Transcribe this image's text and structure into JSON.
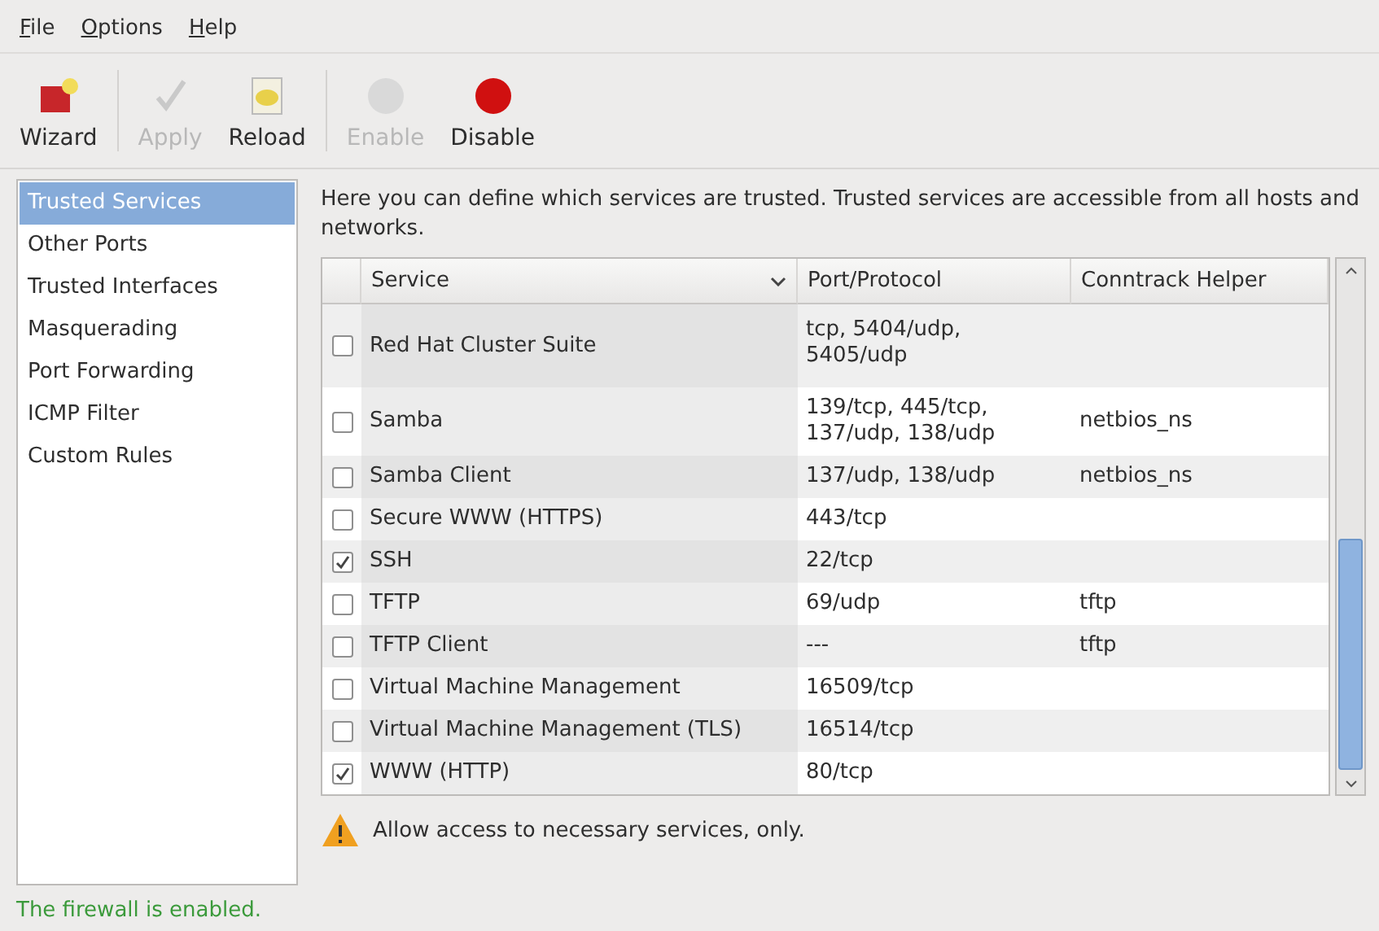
{
  "menu": [
    "File",
    "Options",
    "Help"
  ],
  "toolbar": [
    {
      "label": "Wizard",
      "kind": "wizard",
      "disabled": false
    },
    {
      "label": "Apply",
      "kind": "apply",
      "disabled": true
    },
    {
      "label": "Reload",
      "kind": "reload",
      "disabled": false
    },
    {
      "label": "Enable",
      "kind": "enable",
      "disabled": true
    },
    {
      "label": "Disable",
      "kind": "disable",
      "disabled": false
    }
  ],
  "sidebar": {
    "items": [
      {
        "label": "Trusted Services",
        "selected": true
      },
      {
        "label": "Other Ports",
        "selected": false
      },
      {
        "label": "Trusted Interfaces",
        "selected": false
      },
      {
        "label": "Masquerading",
        "selected": false
      },
      {
        "label": "Port Forwarding",
        "selected": false
      },
      {
        "label": "ICMP Filter",
        "selected": false
      },
      {
        "label": "Custom Rules",
        "selected": false
      }
    ]
  },
  "description": "Here you can define which services are trusted. Trusted services are accessible from all hosts and networks.",
  "table": {
    "columns": [
      "Service",
      "Port/Protocol",
      "Conntrack Helper"
    ],
    "rows": [
      {
        "checked": false,
        "service": "Red Hat Cluster Suite",
        "port": "tcp, 5404/udp, 5405/udp",
        "helper": ""
      },
      {
        "checked": false,
        "service": "Samba",
        "port": "139/tcp, 445/tcp, 137/udp, 138/udp",
        "helper": "netbios_ns"
      },
      {
        "checked": false,
        "service": "Samba Client",
        "port": "137/udp, 138/udp",
        "helper": "netbios_ns"
      },
      {
        "checked": false,
        "service": "Secure WWW (HTTPS)",
        "port": "443/tcp",
        "helper": ""
      },
      {
        "checked": true,
        "service": "SSH",
        "port": "22/tcp",
        "helper": ""
      },
      {
        "checked": false,
        "service": "TFTP",
        "port": "69/udp",
        "helper": "tftp"
      },
      {
        "checked": false,
        "service": "TFTP Client",
        "port": "---",
        "helper": "tftp"
      },
      {
        "checked": false,
        "service": "Virtual Machine Management",
        "port": "16509/tcp",
        "helper": ""
      },
      {
        "checked": false,
        "service": "Virtual Machine Management (TLS)",
        "port": "16514/tcp",
        "helper": ""
      },
      {
        "checked": true,
        "service": "WWW (HTTP)",
        "port": "80/tcp",
        "helper": ""
      }
    ]
  },
  "warning": "Allow access to necessary services, only.",
  "status_bar": "The firewall is enabled."
}
